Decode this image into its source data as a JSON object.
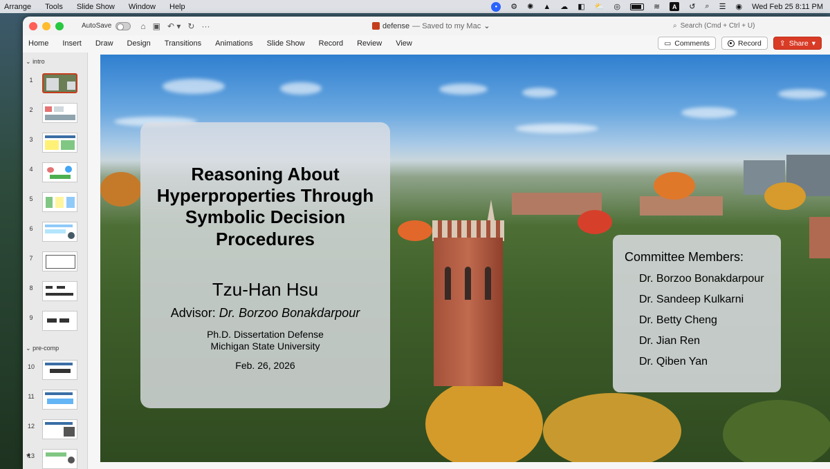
{
  "menubar": {
    "items": [
      "Arrange",
      "Tools",
      "Slide Show",
      "Window",
      "Help"
    ],
    "datetime": "Wed Feb 25  8:11 PM",
    "input_indicator": "A"
  },
  "window": {
    "autosave_label": "AutoSave",
    "doc_name": "defense",
    "doc_status": "— Saved to my Mac",
    "search_placeholder": "Search (Cmd + Ctrl + U)"
  },
  "ribbon": {
    "tabs": [
      "Home",
      "Insert",
      "Draw",
      "Design",
      "Transitions",
      "Animations",
      "Slide Show",
      "Record",
      "Review",
      "View"
    ],
    "comments_label": "Comments",
    "record_label": "Record",
    "share_label": "Share"
  },
  "sidebar": {
    "sections": [
      {
        "label": "intro"
      },
      {
        "label": "pre-comp"
      }
    ],
    "slides": [
      "1",
      "2",
      "3",
      "4",
      "5",
      "6",
      "7",
      "8",
      "9",
      "10",
      "11",
      "12",
      "13"
    ],
    "selected": 1
  },
  "slide": {
    "title": "Reasoning About Hyperproperties Through Symbolic Decision Procedures",
    "author": "Tzu-Han Hsu",
    "advisor_prefix": "Advisor: ",
    "advisor_name": "Dr. Borzoo Bonakdarpour",
    "degree_line1": "Ph.D. Dissertation Defense",
    "degree_line2": "Michigan State University",
    "date": "Feb. 26, 2026",
    "committee_title": "Committee Members:",
    "committee": [
      "Dr. Borzoo Bonakdarpour",
      "Dr. Sandeep Kulkarni",
      "Dr. Betty Cheng",
      "Dr. Jian Ren",
      "Dr. Qiben Yan"
    ]
  },
  "colors": {
    "share_red": "#d83b26",
    "selected_border": "#c43e1c"
  }
}
